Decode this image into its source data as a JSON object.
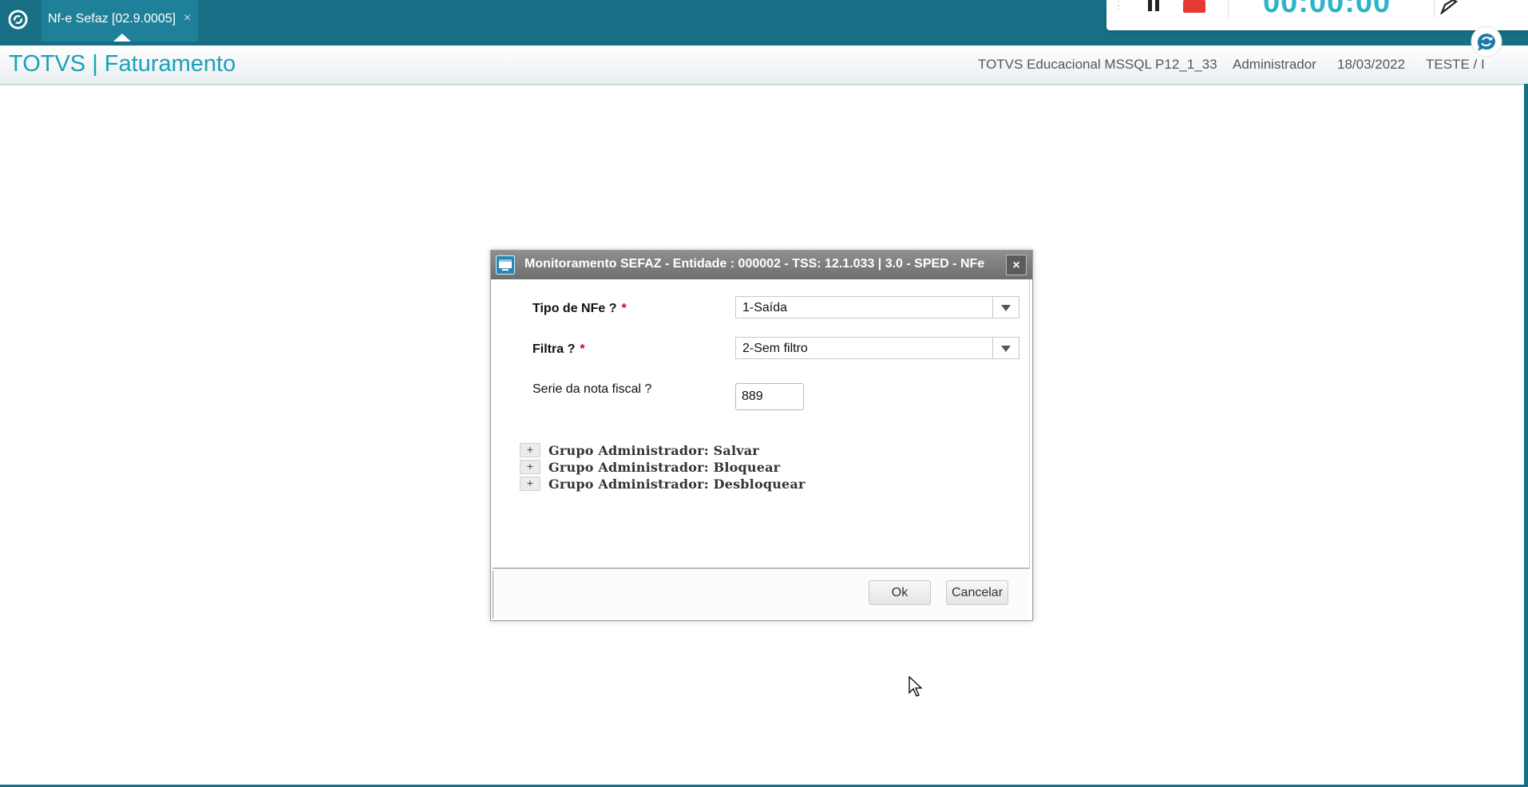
{
  "topbar": {
    "logo_icon": "totvs-logo-icon",
    "tab": {
      "label": "Nf-e Sefaz [02.9.0005]",
      "close_label": "×"
    }
  },
  "recorder": {
    "time": "00:00:00"
  },
  "header": {
    "title": "TOTVS | Faturamento",
    "environment": "TOTVS Educacional MSSQL P12_1_33",
    "user": "Administrador",
    "date": "18/03/2022",
    "branch": "TESTE / I"
  },
  "dialog": {
    "title": "Monitoramento SEFAZ - Entidade : 000002 - TSS: 12.1.033 | 3.0 - SPED - NFe",
    "close_label": "×",
    "fields": {
      "tipo_nfe": {
        "label": "Tipo de NFe ?",
        "required_mark": "*",
        "value": "1-Saída"
      },
      "filtra": {
        "label": "Filtra ?",
        "required_mark": "*",
        "value": "2-Sem filtro"
      },
      "serie": {
        "label": "Serie da nota fiscal ?",
        "value": "889"
      }
    },
    "groups": [
      {
        "toggle": "+",
        "label": "Grupo Administrador: Salvar"
      },
      {
        "toggle": "+",
        "label": "Grupo Administrador: Bloquear"
      },
      {
        "toggle": "+",
        "label": "Grupo Administrador: Desbloquear"
      }
    ],
    "buttons": {
      "ok": "Ok",
      "cancel": "Cancelar"
    }
  },
  "colors": {
    "topbar": "#176f86",
    "accent": "#1aa0bd",
    "dialog_title": "#7a7a7a",
    "required": "#d0021b"
  }
}
